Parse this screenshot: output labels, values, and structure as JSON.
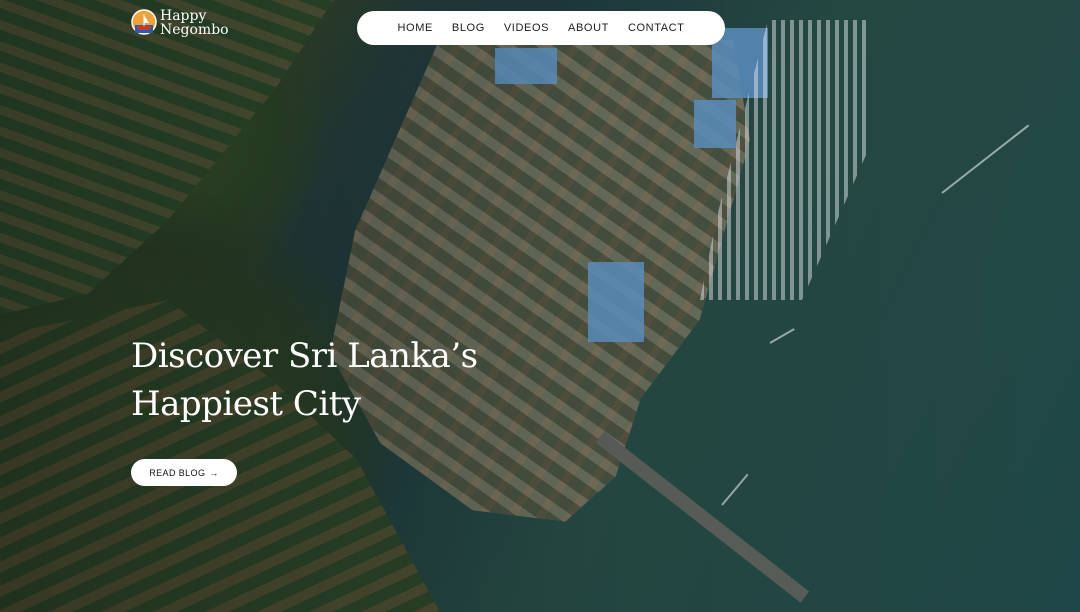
{
  "brand": {
    "line1": "Happy",
    "line2": "Negombo",
    "logo_icon": "sun-boat-emblem"
  },
  "nav": {
    "items": [
      {
        "label": "HOME"
      },
      {
        "label": "BLOG"
      },
      {
        "label": "VIDEOS"
      },
      {
        "label": "ABOUT"
      },
      {
        "label": "CONTACT"
      }
    ]
  },
  "hero": {
    "headline_line1": "Discover Sri Lanka’s",
    "headline_line2": "Happiest City",
    "cta_label": "READ BLOG",
    "cta_icon": "arrow-right-icon",
    "cta_arrow": "→",
    "background": "aerial-photo-lagoon-town"
  },
  "colors": {
    "nav_bg": "#ffffff",
    "text_dark": "#1b1b1b",
    "hero_text": "#ffffff",
    "water": "#1f4747"
  }
}
